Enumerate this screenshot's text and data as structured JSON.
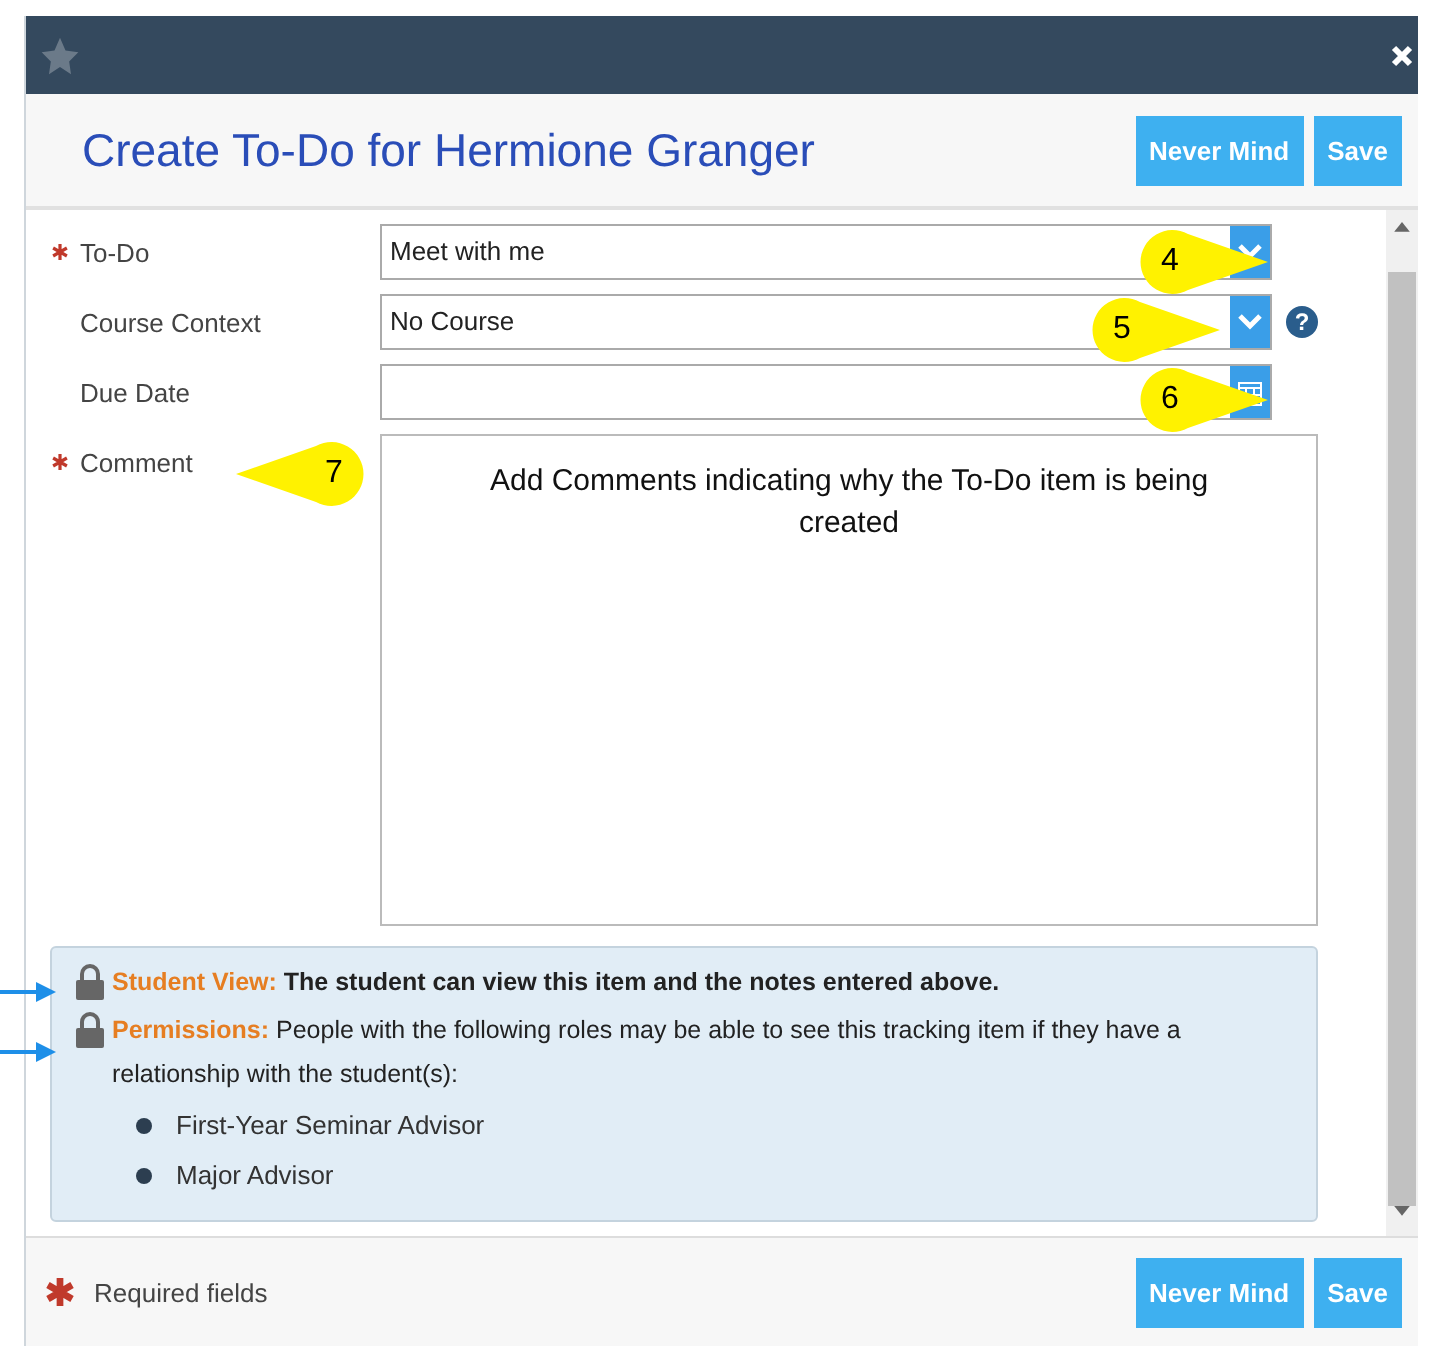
{
  "dialog": {
    "title": "Create To-Do for Hermione Granger",
    "header_buttons": [
      "Never Mind",
      "Save"
    ]
  },
  "fields": [
    {
      "kind": "select",
      "label": "To-Do",
      "required": true,
      "value": "Meet with me"
    },
    {
      "kind": "select",
      "label": "Course Context",
      "required": false,
      "value": "No Course",
      "help": "?"
    },
    {
      "kind": "date",
      "label": "Due Date",
      "required": false
    },
    {
      "kind": "textarea",
      "label": "Comment",
      "required": true,
      "value": "Add Comments indicating why the To-Do item is being created"
    }
  ],
  "callouts": [
    {
      "number": "4"
    },
    {
      "number": "5"
    },
    {
      "number": "6"
    },
    {
      "number": "7"
    }
  ],
  "info": {
    "items": [
      {
        "label": "Student View:",
        "text": "The student can view this item and the notes entered above.",
        "bold": true
      },
      {
        "label": "Permissions:",
        "text": "People with the following roles may be able to see this tracking item if they have a relationship with the student(s):",
        "bold": false
      }
    ],
    "roles": [
      "First-Year Seminar Advisor",
      "Major Advisor"
    ]
  },
  "footer": {
    "required_note": "Required fields",
    "buttons": [
      "Never Mind",
      "Save"
    ]
  }
}
